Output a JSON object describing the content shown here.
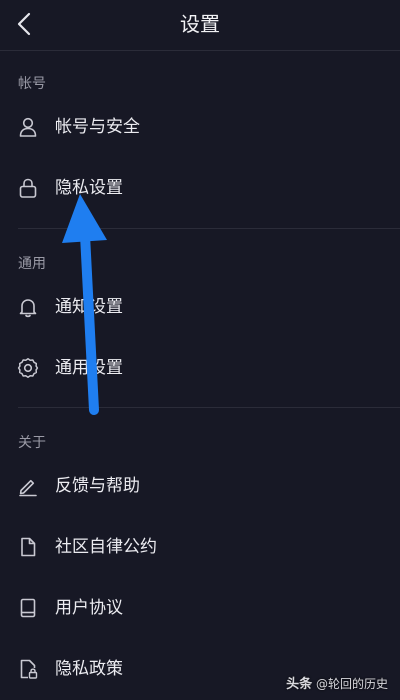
{
  "header": {
    "title": "设置",
    "back_icon": "chevron-left-icon"
  },
  "sections": [
    {
      "label": "帐号",
      "items": [
        {
          "label": "帐号与安全",
          "icon": "user-icon"
        },
        {
          "label": "隐私设置",
          "icon": "lock-icon"
        }
      ]
    },
    {
      "label": "通用",
      "items": [
        {
          "label": "通知设置",
          "icon": "bell-icon"
        },
        {
          "label": "通用设置",
          "icon": "gear-icon"
        }
      ]
    },
    {
      "label": "关于",
      "items": [
        {
          "label": "反馈与帮助",
          "icon": "pencil-icon"
        },
        {
          "label": "社区自律公约",
          "icon": "document-icon"
        },
        {
          "label": "用户协议",
          "icon": "book-icon"
        },
        {
          "label": "隐私政策",
          "icon": "privacy-document-icon"
        }
      ]
    }
  ],
  "annotation": {
    "type": "arrow",
    "color": "#1f7ef0",
    "points_to": "隐私设置"
  },
  "watermark": {
    "brand": "头条",
    "handle": "@轮回的历史"
  },
  "colors": {
    "background": "#171825",
    "text": "#ececf1",
    "section_label": "#9a9aa6",
    "divider": "#2b2c39"
  }
}
